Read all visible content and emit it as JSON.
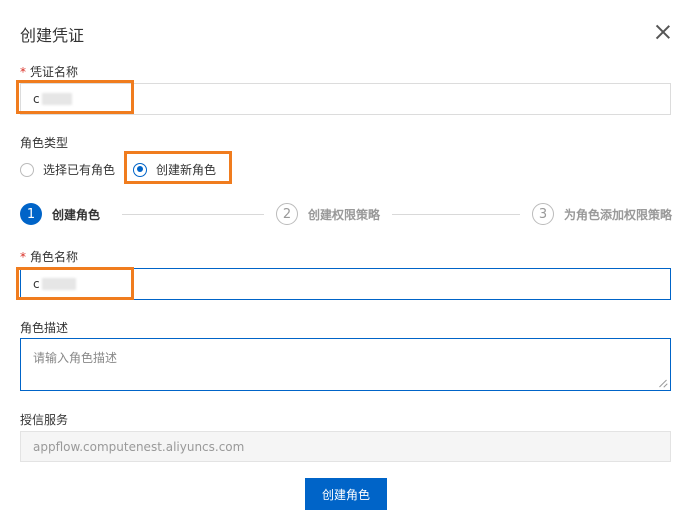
{
  "dialog": {
    "title": "创建凭证"
  },
  "credential_name": {
    "label": "凭证名称",
    "value": "c"
  },
  "role_type": {
    "label": "角色类型",
    "options": [
      {
        "label": "选择已有角色",
        "checked": false
      },
      {
        "label": "创建新角色",
        "checked": true
      }
    ]
  },
  "steps": [
    {
      "num": "1",
      "label": "创建角色",
      "active": true
    },
    {
      "num": "2",
      "label": "创建权限策略",
      "active": false
    },
    {
      "num": "3",
      "label": "为角色添加权限策略",
      "active": false
    }
  ],
  "role_name": {
    "label": "角色名称",
    "value": "c"
  },
  "role_desc": {
    "label": "角色描述",
    "placeholder": "请输入角色描述"
  },
  "trusted_service": {
    "label": "授信服务",
    "value": "appflow.computenest.aliyuncs.com"
  },
  "submit": {
    "label": "创建角色"
  },
  "colors": {
    "primary": "#0064c8",
    "highlight": "#f07c1e",
    "required": "#d93026"
  }
}
